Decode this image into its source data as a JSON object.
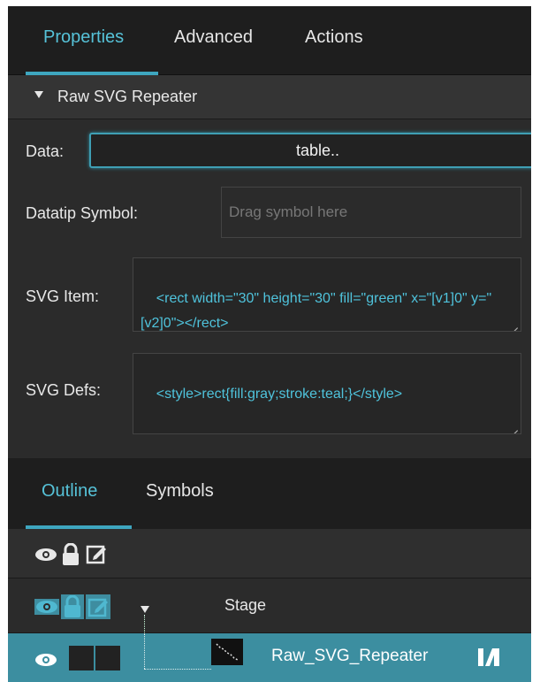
{
  "tabs": [
    {
      "label": "Properties",
      "active": true
    },
    {
      "label": "Advanced",
      "active": false
    },
    {
      "label": "Actions",
      "active": false
    }
  ],
  "section": {
    "title": "Raw SVG Repeater"
  },
  "fields": {
    "data_label": "Data:",
    "data_value": "table..",
    "datatip_label": "Datatip Symbol:",
    "datatip_placeholder": "Drag symbol here",
    "svg_item_label": "SVG Item:",
    "svg_item_value": "<rect width=\"30\" height=\"30\" fill=\"green\" x=\"[v1]0\" y=\"[v2]0\"></rect>",
    "svg_defs_label": "SVG Defs:",
    "svg_defs_value": "<style>rect{fill:gray;stroke:teal;}</style>"
  },
  "outline": {
    "tabs": [
      {
        "label": "Outline",
        "active": true
      },
      {
        "label": "Symbols",
        "active": false
      }
    ],
    "header_icons": [
      "eye-icon",
      "lock-icon",
      "edit-icon"
    ],
    "rows": [
      {
        "label": "Stage"
      },
      {
        "label": "Raw_SVG_Repeater",
        "selected": true
      }
    ]
  },
  "colors": {
    "accent": "#56c2d8",
    "panel_bg": "#2b2b2b",
    "selected_row": "#3c8ea0"
  }
}
